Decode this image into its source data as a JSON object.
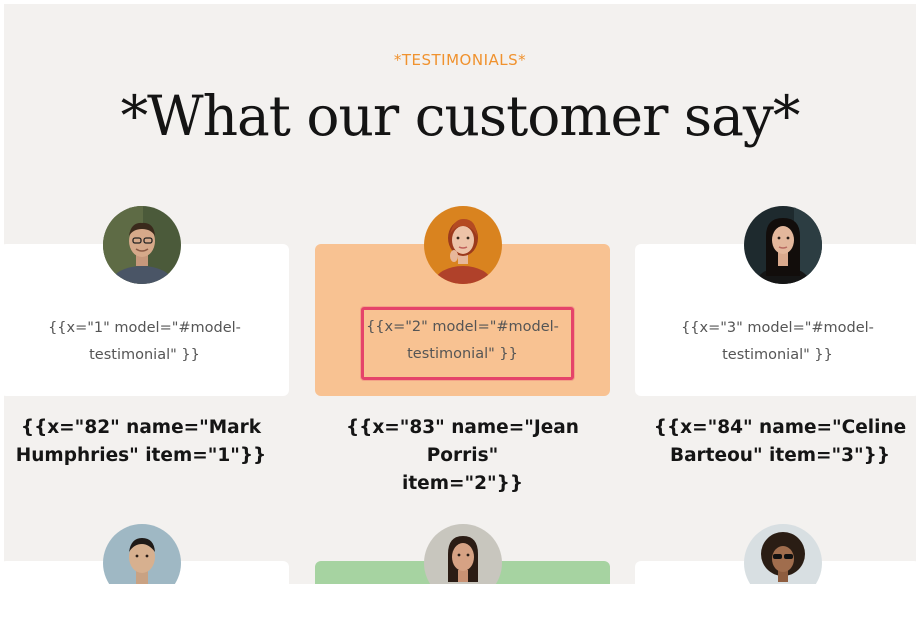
{
  "section": {
    "eyebrow": "*TESTIMONIALS*",
    "heading": "*What our customer say*"
  },
  "testimonials": [
    {
      "quote_line1": "{{x=\"1\" model=\"#model-",
      "quote_line2": "testimonial\" }}",
      "name_line1": "{{x=\"82\" name=\"Mark",
      "name_line2": "Humphries\" item=\"1\"}}"
    },
    {
      "quote_line1": "{{x=\"2\" model=\"#model-",
      "quote_line2": "testimonial\" }}",
      "name_line1": "{{x=\"83\" name=\"Jean Porris\"",
      "name_line2": "item=\"2\"}}"
    },
    {
      "quote_line1": "{{x=\"3\" model=\"#model-",
      "quote_line2": "testimonial\" }}",
      "name_line1": "{{x=\"84\" name=\"Celine",
      "name_line2": "Barteou\" item=\"3\"}}"
    }
  ],
  "colors": {
    "accent": "#f0922e",
    "highlight_card": "#f8c292",
    "green_card": "#a6d3a1",
    "focus_frame": "#e5436a"
  }
}
